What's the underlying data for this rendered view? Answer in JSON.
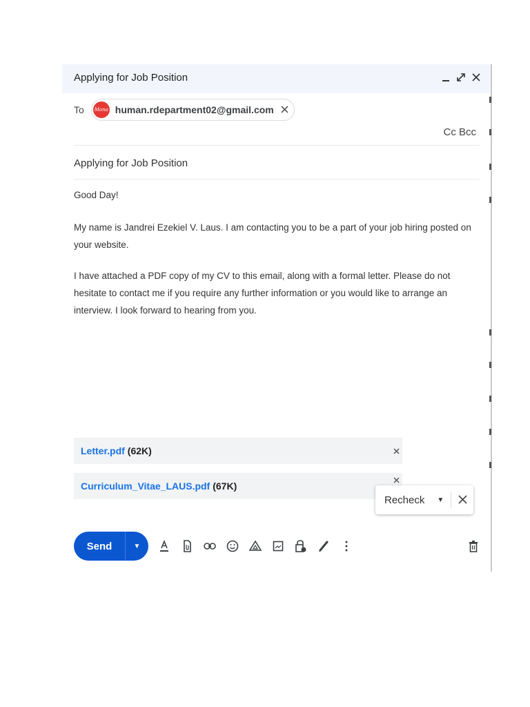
{
  "window": {
    "title": "Applying for Job Position",
    "minimize_icon": "minimize-icon",
    "expand_icon": "expand-icon",
    "close_icon": "close-icon"
  },
  "recipients": {
    "to_label": "To",
    "chip": {
      "email": "human.rdepartment02@gmail.com",
      "avatar_text": "Mona"
    },
    "cc_bcc": "Cc Bcc"
  },
  "subject": "Applying for Job Position",
  "body": {
    "greeting": "Good Day!",
    "paragraph1": "My name is Jandrei Ezekiel V. Laus. I am contacting you to be a part of your job hiring posted on your website.",
    "paragraph2": "I have attached a PDF copy of my CV to this email, along with a formal letter. Please do not hesitate to contact me if you require any further information or you would like to arrange an interview. I look forward to hearing from you."
  },
  "attachments": [
    {
      "name": "Letter.pdf",
      "size": "(62K)"
    },
    {
      "name": "Curriculum_Vitae_LAUS.pdf",
      "size": "(67K)"
    }
  ],
  "recheck_popup": {
    "label": "Recheck"
  },
  "toolbar": {
    "send_label": "Send",
    "icons": [
      "formatting-icon",
      "attach-icon",
      "link-icon",
      "emoji-icon",
      "drive-icon",
      "photo-icon",
      "lock-icon",
      "signature-icon",
      "more-options-icon",
      "trash-icon"
    ]
  },
  "colors": {
    "accent": "#0b57d0",
    "link": "#1a73e8",
    "header_bg": "#f2f6fc",
    "avatar": "#e53935"
  }
}
